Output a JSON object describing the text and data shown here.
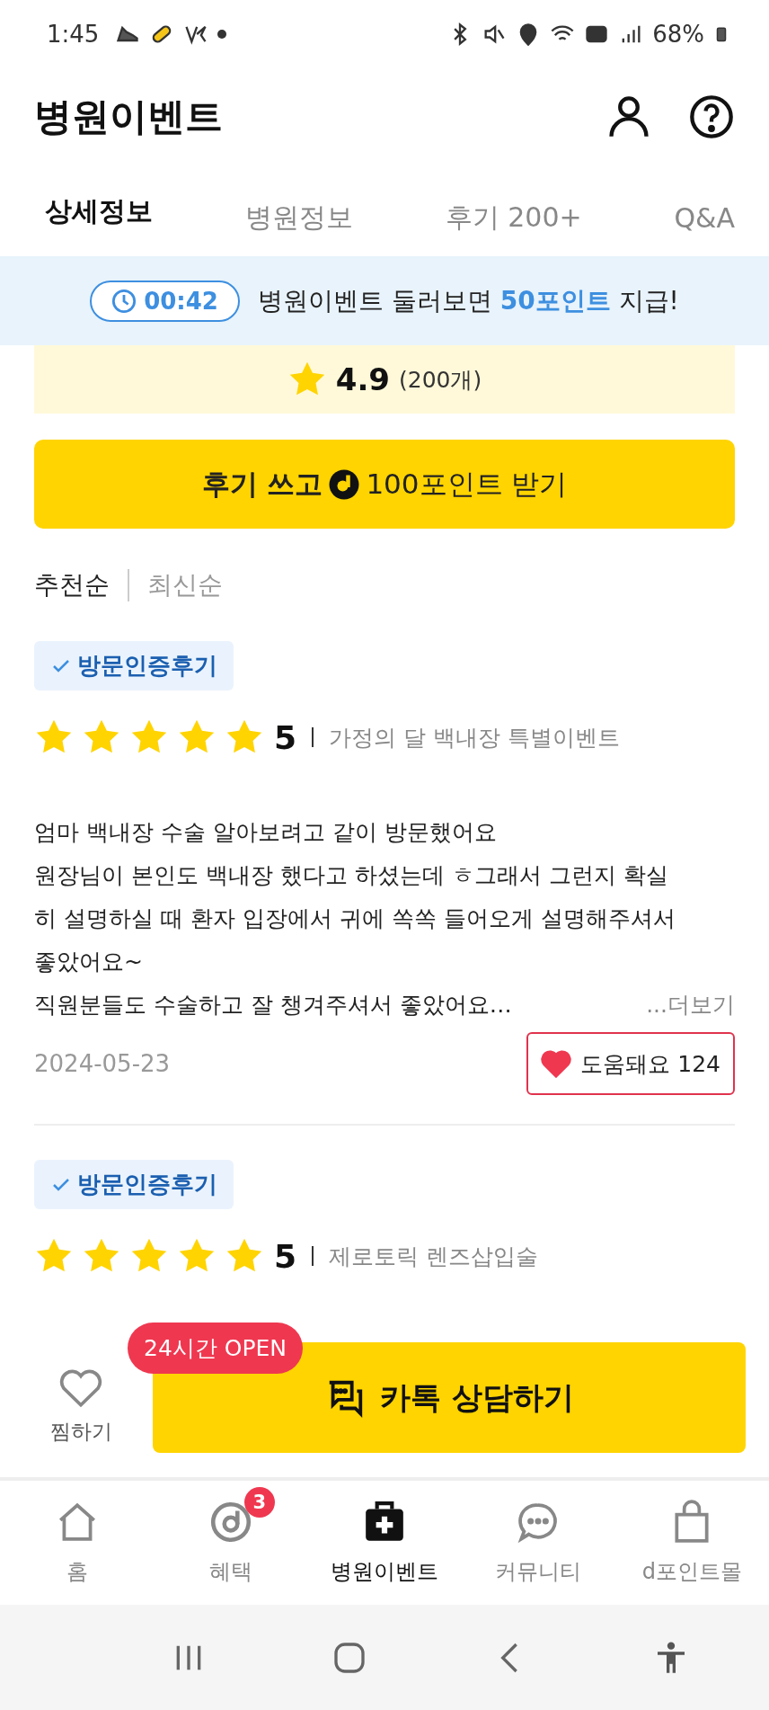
{
  "status_bar": {
    "time": "1:45",
    "battery": "68%"
  },
  "header": {
    "title": "병원이벤트"
  },
  "tabs": [
    {
      "label": "상세정보",
      "selected": true
    },
    {
      "label": "병원정보",
      "selected": false
    },
    {
      "label": "후기 200+",
      "selected": false
    },
    {
      "label": "Q&A",
      "selected": false
    }
  ],
  "banner": {
    "timer": "00:42",
    "message_parts": [
      {
        "text": "병원이벤트 둘러보면 ",
        "highlight": false
      },
      {
        "text": "50포인트",
        "highlight": true
      },
      {
        "text": " 지급!",
        "highlight": false
      }
    ]
  },
  "rating_summary": {
    "score": "4.9",
    "count": "(200개)"
  },
  "write_review_button": {
    "label_before": "후기 쓰고",
    "label_after": "100포인트 받기"
  },
  "sort_options": [
    {
      "label": "추천순",
      "selected": true
    },
    {
      "label": "최신순",
      "selected": false
    }
  ],
  "reviews": [
    {
      "badge": "방문인증후기",
      "stars": 5,
      "rating": "5",
      "event": "가정의 달 백내장 특별이벤트",
      "lines": [
        "엄마 백내장 수술 알아보려고 같이 방문했어요",
        "원장님이 본인도 백내장 했다고 하셨는데 ㅎ그래서 그런지 확실",
        "히 설명하실 때 환자 입장에서 귀에 쏙쏙 들어오게 설명해주셔서",
        "좋았어요~",
        "직원분들도 수술하고 잘 챙겨주셔서 좋았어요…"
      ],
      "more": "...더보기",
      "date": "2024-05-23",
      "helpful": {
        "label": "도움돼요 124",
        "liked": true
      }
    },
    {
      "badge": "방문인증후기",
      "stars": 5,
      "rating": "5",
      "event": "제로토릭 렌즈삽입술"
    }
  ],
  "action_bar": {
    "wishlist": {
      "label": "찜하기",
      "on": false
    },
    "open_badge": "24시간 OPEN",
    "chat_button": "카톡 상담하기"
  },
  "bottom_nav": [
    {
      "kind": "home",
      "label": "홈",
      "selected": false
    },
    {
      "kind": "benefit",
      "label": "혜택",
      "selected": false,
      "badge": "3"
    },
    {
      "kind": "hospital",
      "label": "병원이벤트",
      "selected": true
    },
    {
      "kind": "community",
      "label": "커뮤니티",
      "selected": false
    },
    {
      "kind": "mall",
      "label": "d포인트몰",
      "selected": false
    }
  ]
}
